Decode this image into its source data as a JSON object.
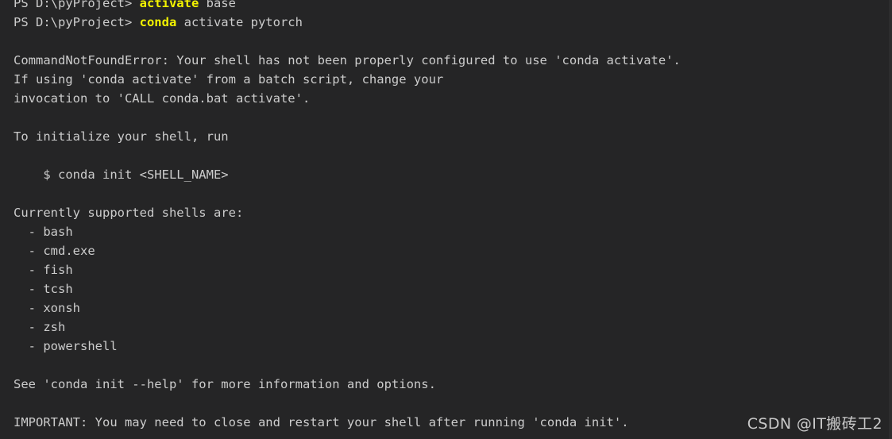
{
  "terminal": {
    "background_color": "#252526",
    "text_color": "#cccccc",
    "command_highlight_color": "#f2f200",
    "font_size_px": 15.5,
    "line_height_px": 24,
    "lines": [
      {
        "id": "line-prev-prompt",
        "kind": "prompt",
        "clipped": true,
        "prompt": "PS D:\\pyProject> ",
        "command": "activate",
        "args": " base"
      },
      {
        "id": "line-prompt",
        "kind": "prompt",
        "clipped": false,
        "prompt": "PS D:\\pyProject> ",
        "command": "conda",
        "args": " activate pytorch"
      },
      {
        "id": "line-blank-1",
        "kind": "blank",
        "text": ""
      },
      {
        "id": "line-error-title",
        "kind": "text",
        "text": "CommandNotFoundError: Your shell has not been properly configured to use 'conda activate'."
      },
      {
        "id": "line-error-body-1",
        "kind": "text",
        "text": "If using 'conda activate' from a batch script, change your"
      },
      {
        "id": "line-error-body-2",
        "kind": "text",
        "text": "invocation to 'CALL conda.bat activate'."
      },
      {
        "id": "line-blank-2",
        "kind": "blank",
        "text": ""
      },
      {
        "id": "line-init-instruction",
        "kind": "text",
        "text": "To initialize your shell, run"
      },
      {
        "id": "line-blank-3",
        "kind": "blank",
        "text": ""
      },
      {
        "id": "line-init-command",
        "kind": "text",
        "text": "    $ conda init <SHELL_NAME>"
      },
      {
        "id": "line-blank-4",
        "kind": "blank",
        "text": ""
      },
      {
        "id": "line-shells-header",
        "kind": "text",
        "text": "Currently supported shells are:"
      },
      {
        "id": "line-shell-bash",
        "kind": "text",
        "text": "  - bash"
      },
      {
        "id": "line-shell-cmdexe",
        "kind": "text",
        "text": "  - cmd.exe"
      },
      {
        "id": "line-shell-fish",
        "kind": "text",
        "text": "  - fish"
      },
      {
        "id": "line-shell-tcsh",
        "kind": "text",
        "text": "  - tcsh"
      },
      {
        "id": "line-shell-xonsh",
        "kind": "text",
        "text": "  - xonsh"
      },
      {
        "id": "line-shell-zsh",
        "kind": "text",
        "text": "  - zsh"
      },
      {
        "id": "line-shell-powershell",
        "kind": "text",
        "text": "  - powershell"
      },
      {
        "id": "line-blank-5",
        "kind": "blank",
        "text": ""
      },
      {
        "id": "line-see-help",
        "kind": "text",
        "text": "See 'conda init --help' for more information and options."
      },
      {
        "id": "line-blank-6",
        "kind": "blank",
        "text": ""
      },
      {
        "id": "line-important",
        "kind": "text",
        "text": "IMPORTANT: You may need to close and restart your shell after running 'conda init'."
      }
    ]
  },
  "watermark": {
    "text": "CSDN @IT搬砖工2"
  }
}
